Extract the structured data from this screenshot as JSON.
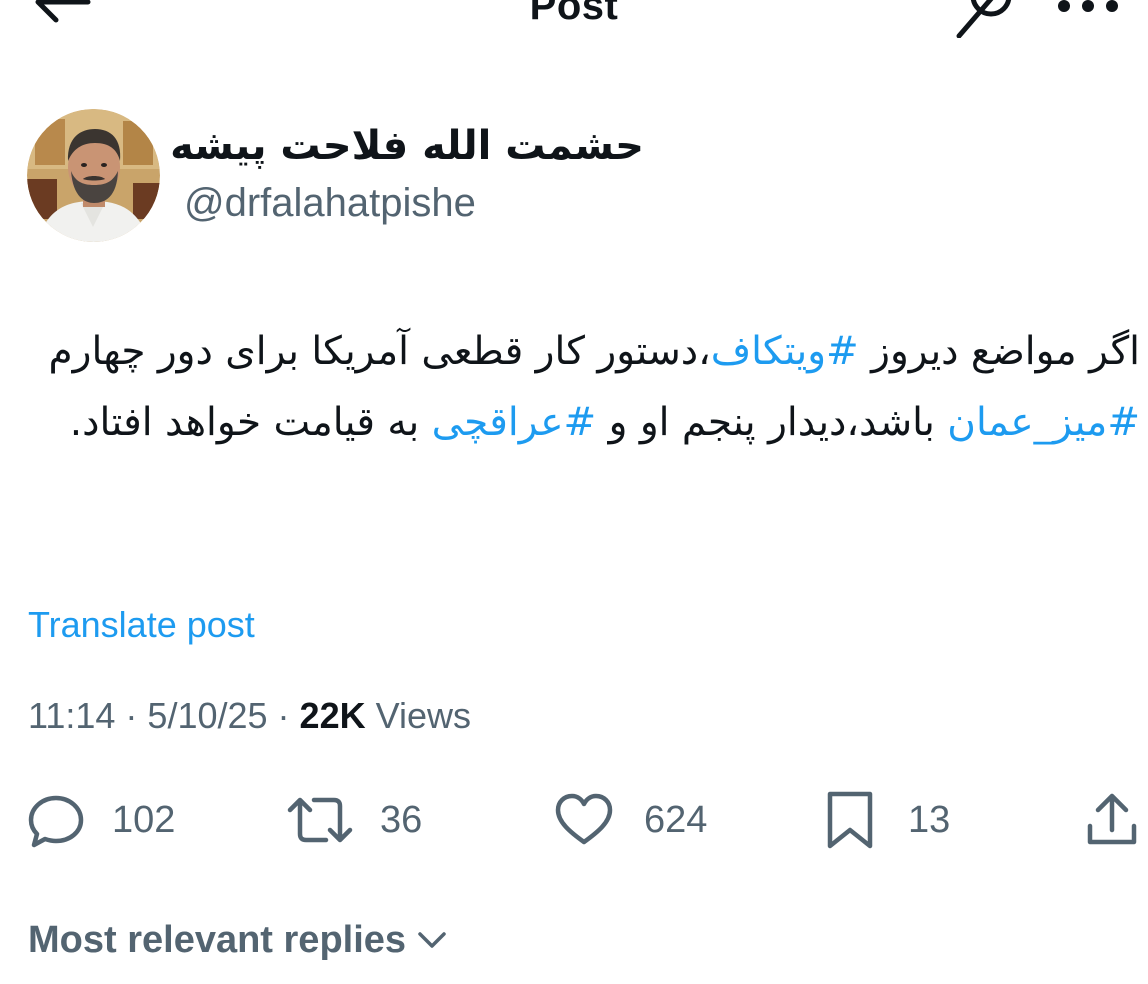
{
  "header": {
    "title": "Post"
  },
  "author": {
    "name": "حشمت الله فلاحت پیشه",
    "handle": "@drfalahatpishe"
  },
  "post": {
    "line1_part1": "اگر مواضع دیروز ",
    "hashtag1": "#ویتکاف",
    "line1_part2": "،دستور کار قطعی آمریکا برای دور چهارم ",
    "hashtag2": "#میز_عمان",
    "line1_part3": " باشد،دیدار پنجم او و ",
    "hashtag3": "#عراقچی",
    "line1_part4": " به قیامت خواهد افتاد.",
    "translate_label": "Translate post"
  },
  "meta": {
    "time": "11:14",
    "sep1": " · ",
    "date": "5/10/25",
    "sep2": " · ",
    "views_count": "22K",
    "views_label": " Views"
  },
  "actions": {
    "replies": "102",
    "reposts": "36",
    "likes": "624",
    "bookmarks": "13"
  },
  "replies_sort": {
    "label": "Most relevant replies"
  },
  "colors": {
    "accent": "#1d9bf0",
    "text": "#0f1419",
    "muted": "#536471"
  }
}
